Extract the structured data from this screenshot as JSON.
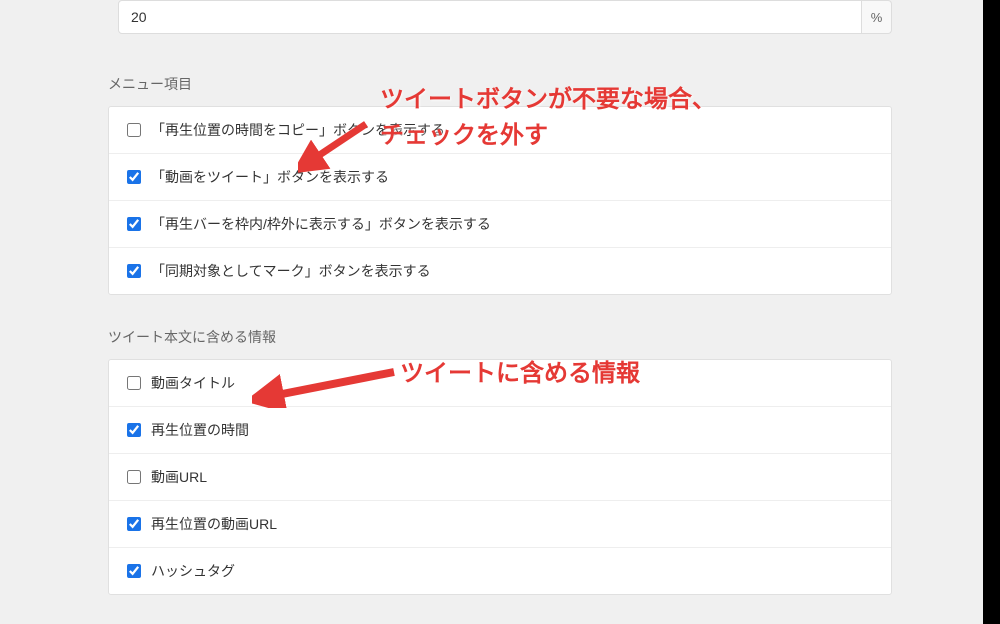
{
  "topInput": {
    "value": "20",
    "unit": "%"
  },
  "sections": {
    "menuItems": {
      "label": "メニュー項目",
      "items": [
        {
          "label": "「再生位置の時間をコピー」ボタンを表示する",
          "checked": false
        },
        {
          "label": "「動画をツイート」ボタンを表示する",
          "checked": true
        },
        {
          "label": "「再生バーを枠内/枠外に表示する」ボタンを表示する",
          "checked": true
        },
        {
          "label": "「同期対象としてマーク」ボタンを表示する",
          "checked": true
        }
      ]
    },
    "tweetInfo": {
      "label": "ツイート本文に含める情報",
      "items": [
        {
          "label": "動画タイトル",
          "checked": false
        },
        {
          "label": "再生位置の時間",
          "checked": true
        },
        {
          "label": "動画URL",
          "checked": false
        },
        {
          "label": "再生位置の動画URL",
          "checked": true
        },
        {
          "label": "ハッシュタグ",
          "checked": true
        }
      ]
    }
  },
  "annotations": {
    "top": "ツイートボタンが不要な場合、\nチェックを外す",
    "bottom": "ツイートに含める情報"
  }
}
